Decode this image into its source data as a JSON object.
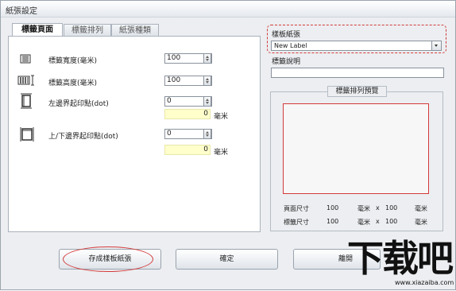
{
  "window": {
    "title": "紙張設定"
  },
  "tabs": [
    "標籤頁面",
    "標籤排列",
    "紙張種類"
  ],
  "rows": {
    "width": {
      "label": "標籤寬度(毫米)",
      "value": "100"
    },
    "height": {
      "label": "標籤高度(毫米)",
      "value": "100"
    },
    "left": {
      "label": "左邊界起印點(dot)",
      "value": "0",
      "readout": "0",
      "unit": "毫米"
    },
    "top": {
      "label": "上/下邊界起印點(dot)",
      "value": "0",
      "readout": "0",
      "unit": "毫米"
    }
  },
  "template": {
    "label": "樣板紙張",
    "selected": "New Label",
    "desc_label": "標籤說明",
    "desc_value": ""
  },
  "preview": {
    "title": "標籤排列預覽",
    "page_label": "頁面尺寸",
    "page_w": "100",
    "page_unit1": "毫米",
    "x": "x",
    "page_h": "100",
    "page_unit2": "毫米",
    "label_label": "標籤尺寸",
    "label_w": "100",
    "label_unit1": "毫米",
    "label_h": "100",
    "label_unit2": "毫米"
  },
  "buttons": {
    "save_template": "存成樣板紙張",
    "ok": "確定",
    "leave": "離開"
  },
  "watermark": {
    "brand": "下载吧",
    "url": "www.xiazaiba.com"
  },
  "colors": {
    "highlight": "#d43a3a",
    "readout_bg": "#ffffcc"
  }
}
